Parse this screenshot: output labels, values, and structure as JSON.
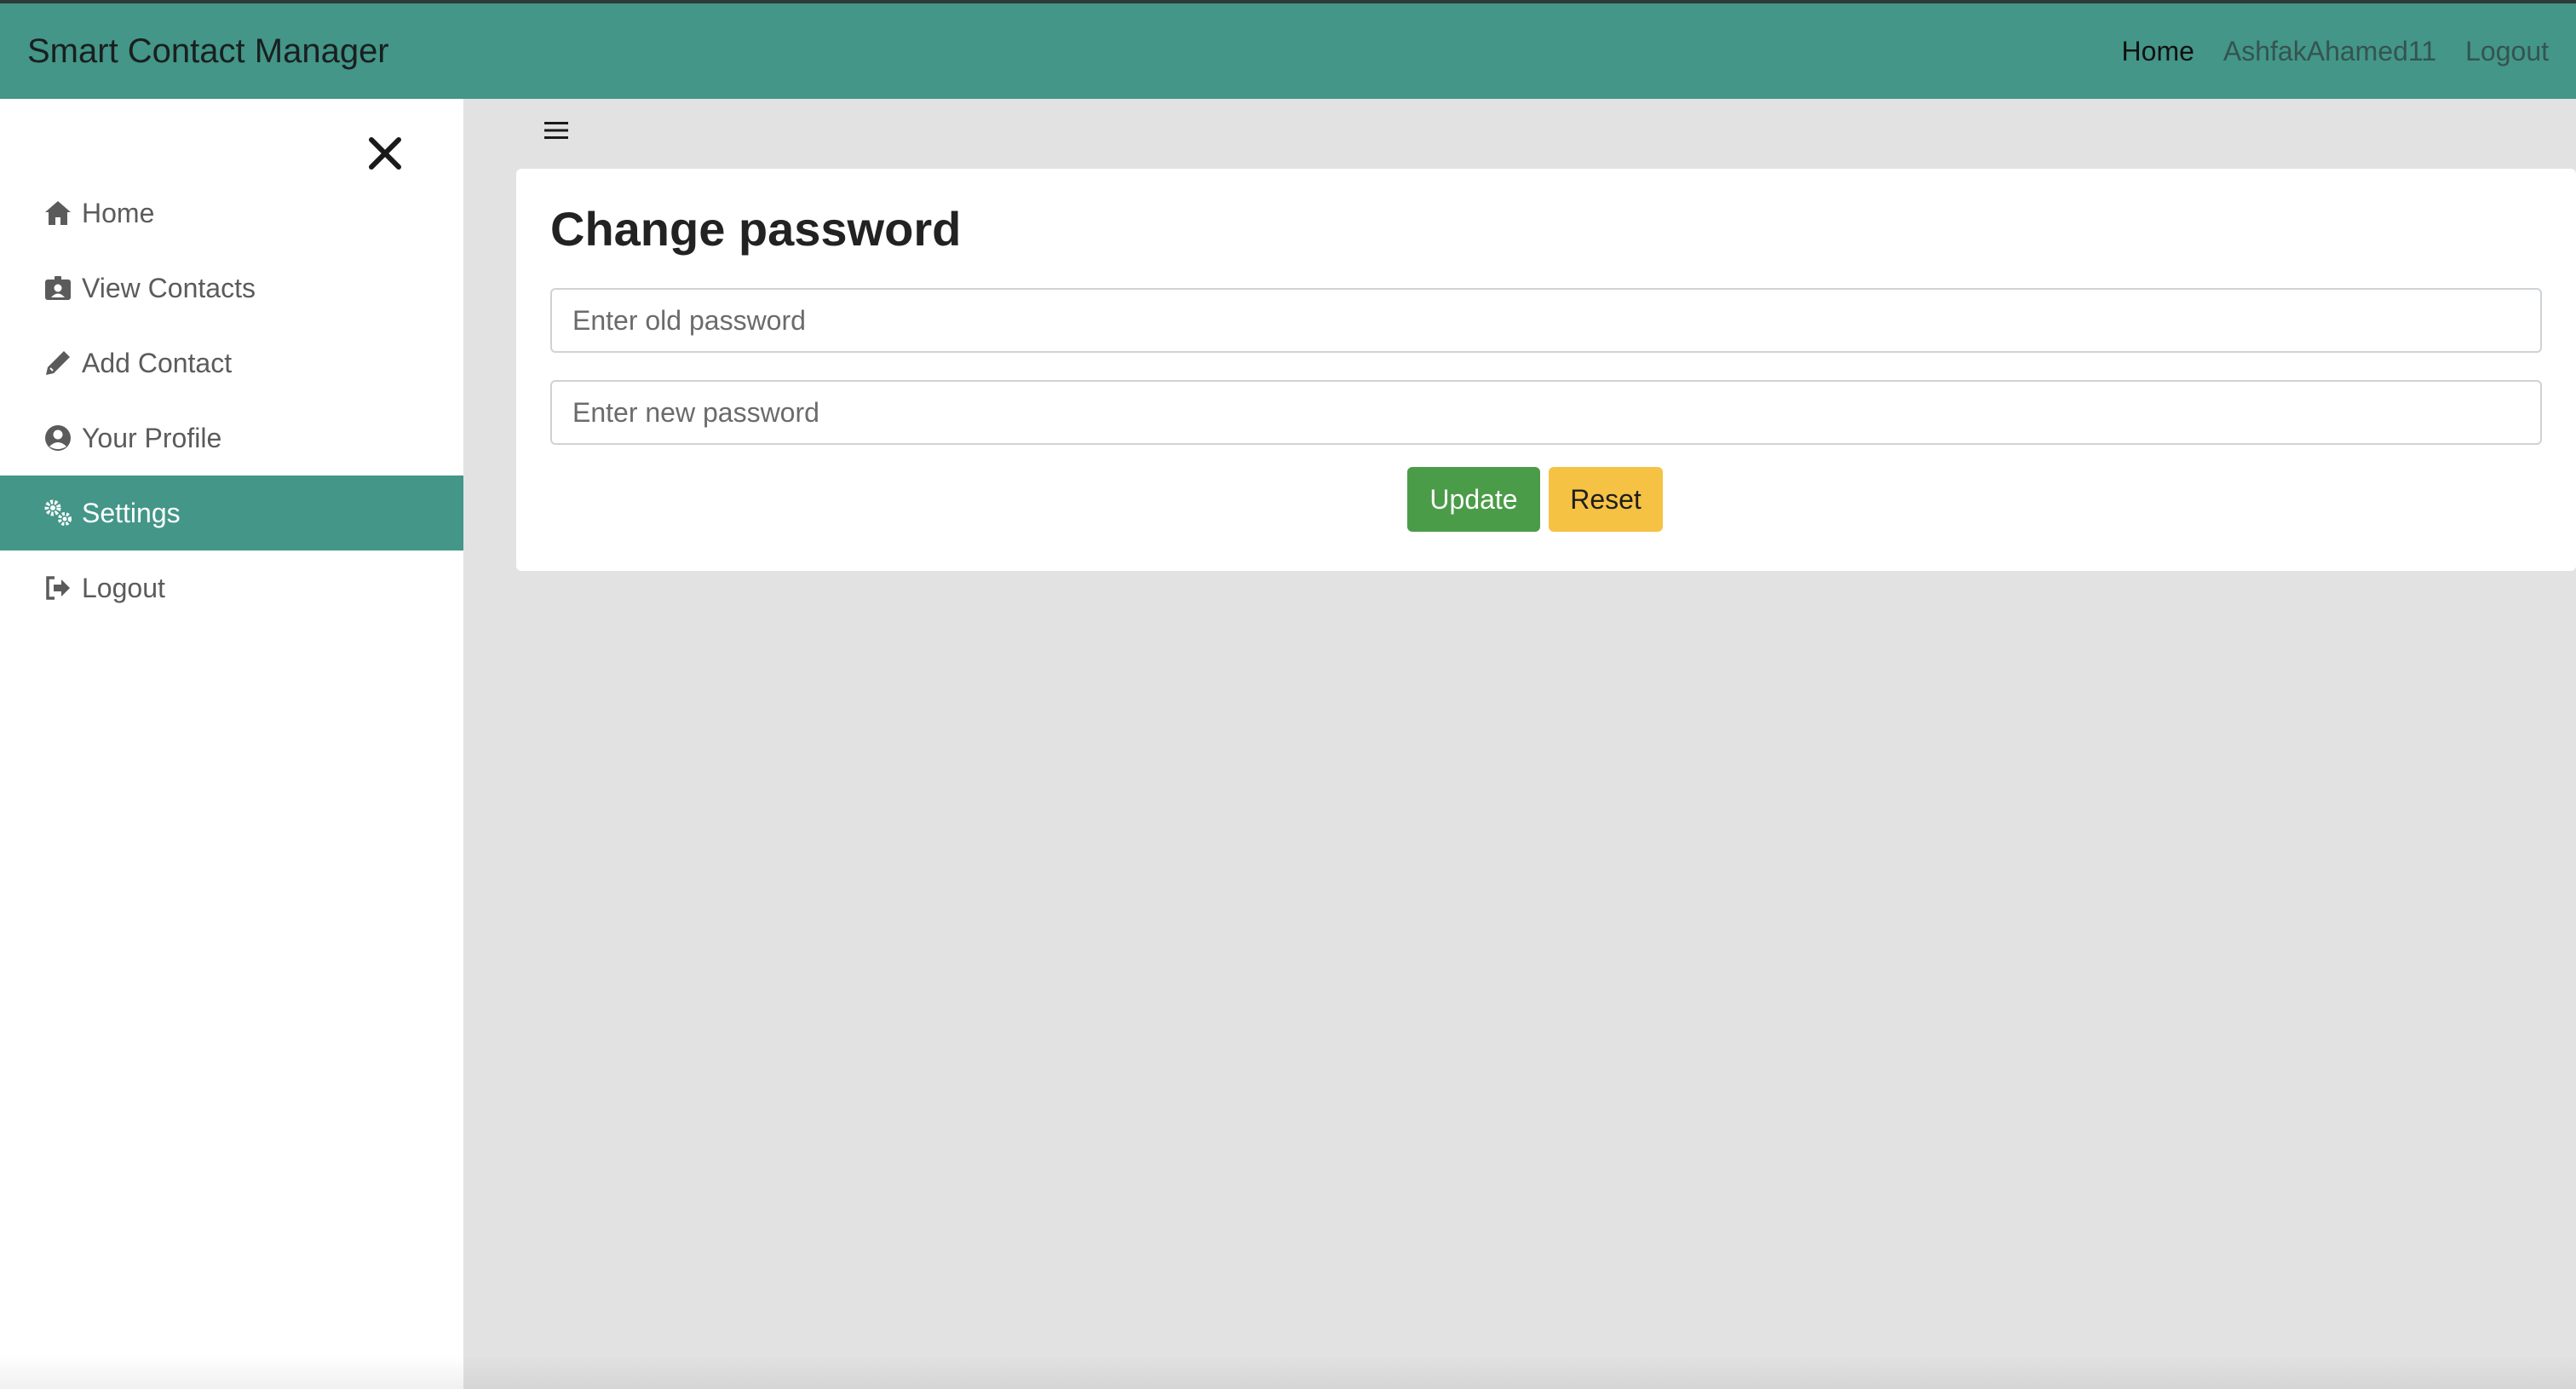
{
  "navbar": {
    "brand": "Smart Contact Manager",
    "links": [
      {
        "label": "Home"
      },
      {
        "label": "AshfakAhamed11"
      },
      {
        "label": "Logout"
      }
    ]
  },
  "sidebar": {
    "items": [
      {
        "label": "Home",
        "icon": "home-icon"
      },
      {
        "label": "View Contacts",
        "icon": "id-badge-icon"
      },
      {
        "label": "Add Contact",
        "icon": "pencil-icon"
      },
      {
        "label": "Your Profile",
        "icon": "user-circle-icon"
      },
      {
        "label": "Settings",
        "icon": "gears-icon",
        "active": true
      },
      {
        "label": "Logout",
        "icon": "sign-out-icon"
      }
    ]
  },
  "form": {
    "title": "Change password",
    "old_password_placeholder": "Enter old password",
    "new_password_placeholder": "Enter new password",
    "update_label": "Update",
    "reset_label": "Reset"
  },
  "colors": {
    "accent": "#439688",
    "update": "#4a9c48",
    "reset": "#f6c244"
  }
}
